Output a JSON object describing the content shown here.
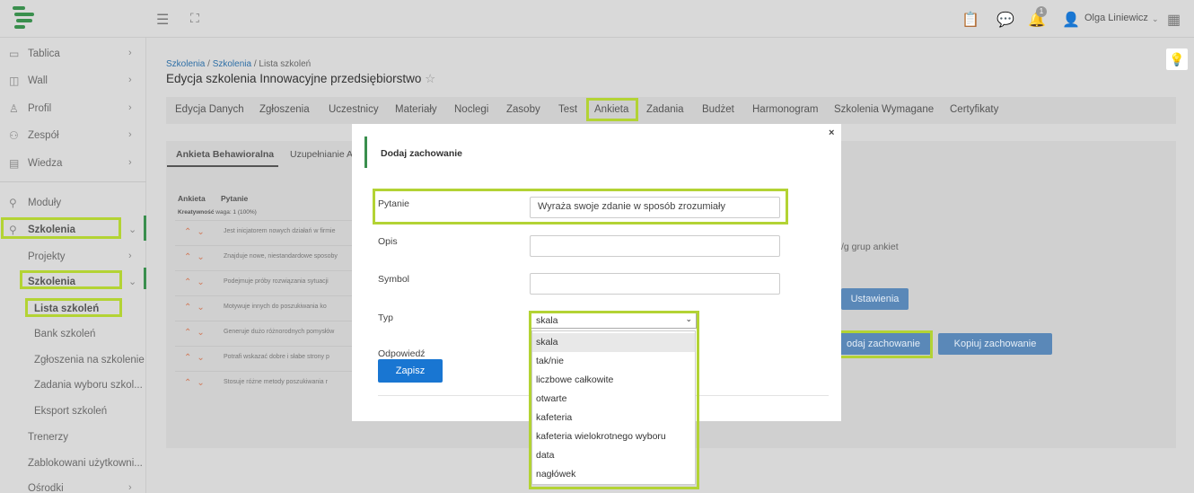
{
  "topbar": {
    "user_name": "Olga Liniewicz",
    "notification_count": "1"
  },
  "sidebar": {
    "items": [
      {
        "label": "Tablica"
      },
      {
        "label": "Wall"
      },
      {
        "label": "Profil"
      },
      {
        "label": "Zespół"
      },
      {
        "label": "Wiedza"
      },
      {
        "label": "Moduły"
      },
      {
        "label": "Szkolenia"
      },
      {
        "label": "Projekty"
      },
      {
        "label": "Szkolenia"
      },
      {
        "label": "Lista szkoleń"
      },
      {
        "label": "Bank szkoleń"
      },
      {
        "label": "Zgłoszenia na szkolenie"
      },
      {
        "label": "Zadania wyboru szkol..."
      },
      {
        "label": "Eksport szkoleń"
      },
      {
        "label": "Trenerzy"
      },
      {
        "label": "Zablokowani użytkowni..."
      },
      {
        "label": "Ośrodki"
      }
    ]
  },
  "breadcrumb": {
    "part1": "Szkolenia",
    "sep1": " / ",
    "part2": "Szkolenia",
    "sep2": " / ",
    "part3": "Lista szkoleń"
  },
  "page_title": "Edycja szkolenia Innowacyjne przedsiębiorstwo",
  "tabs": [
    "Edycja Danych",
    "Zgłoszenia",
    "Uczestnicy",
    "Materiały",
    "Noclegi",
    "Zasoby",
    "Test",
    "Ankieta",
    "Zadania",
    "Budżet",
    "Harmonogram",
    "Szkolenia Wymagane",
    "Certyfikaty"
  ],
  "subtabs": [
    "Ankieta Behawioralna",
    "Uzupełnianie An"
  ],
  "table": {
    "col1": "Ankieta",
    "col2": "Pytanie",
    "group_label": "Kreatywność",
    "group_weight": "waga: 1 (100%)",
    "rows": [
      "Jest inicjatorem nowych działań w firmie",
      "Znajduje nowe, niestandardowe sposoby",
      "Podejmuje próby rozwiązania sytuacji",
      "Motywuje innych do poszukiwania ko",
      "Generuje dużo różnorodnych pomysłów",
      "Potrafi wskazać dobre i słabe strony p",
      "Stosuje różne metody poszukiwania r"
    ]
  },
  "right_panel": {
    "groups_text": "/g grup ankiet",
    "settings_button": "Ustawienia",
    "add_behavior_button": "odaj zachowanie",
    "copy_behavior_button": "Kopiuj zachowanie"
  },
  "modal": {
    "title": "Dodaj zachowanie",
    "close": "×",
    "question_label": "Pytanie",
    "question_value": "Wyraża swoje zdanie w sposób zrozumiały",
    "description_label": "Opis",
    "description_value": "",
    "symbol_label": "Symbol",
    "symbol_value": "",
    "type_label": "Typ",
    "type_value": "skala",
    "answer_label": "Odpowiedź",
    "save_button": "Zapisz"
  },
  "type_options": [
    "skala",
    "tak/nie",
    "liczbowe całkowite",
    "otwarte",
    "kafeteria",
    "kafeteria wielokrotnego wyboru",
    "data",
    "nagłówek"
  ],
  "colors": {
    "highlight": "#b3d334",
    "brand_green": "#3a8f4e",
    "primary_blue": "#1976d2"
  }
}
